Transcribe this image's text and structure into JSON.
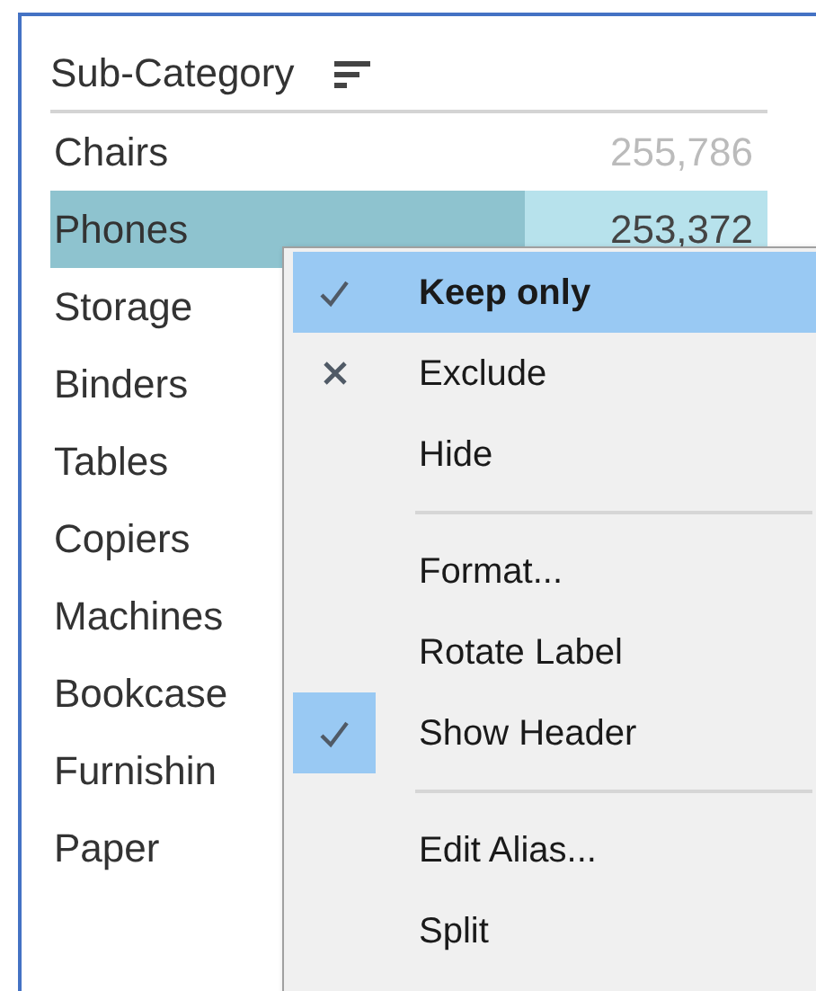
{
  "table": {
    "header": "Sub-Category",
    "rows": [
      {
        "label": "Chairs",
        "value": "255,786",
        "selected": false
      },
      {
        "label": "Phones",
        "value": "253,372",
        "selected": true
      },
      {
        "label": "Storage",
        "selected": false
      },
      {
        "label": "Binders",
        "selected": false
      },
      {
        "label": "Tables",
        "selected": false
      },
      {
        "label": "Copiers",
        "selected": false
      },
      {
        "label": "Machines",
        "selected": false
      },
      {
        "label": "Bookcase",
        "selected": false
      },
      {
        "label": "Furnishin",
        "selected": false
      },
      {
        "label": "Paper",
        "selected": false
      }
    ]
  },
  "context_menu": {
    "groups": [
      [
        {
          "label": "Keep only",
          "kind": "check",
          "selected": true,
          "checked": false
        },
        {
          "label": "Exclude",
          "kind": "cross",
          "selected": false,
          "checked": false
        },
        {
          "label": "Hide",
          "kind": "plain",
          "selected": false,
          "checked": false
        }
      ],
      [
        {
          "label": "Format...",
          "kind": "plain",
          "selected": false,
          "checked": false
        },
        {
          "label": "Rotate Label",
          "kind": "plain",
          "selected": false,
          "checked": false
        },
        {
          "label": "Show Header",
          "kind": "check",
          "selected": false,
          "checked": true
        }
      ],
      [
        {
          "label": "Edit Alias...",
          "kind": "plain",
          "selected": false,
          "checked": false
        },
        {
          "label": "Split",
          "kind": "plain",
          "selected": false,
          "checked": false
        }
      ]
    ]
  }
}
